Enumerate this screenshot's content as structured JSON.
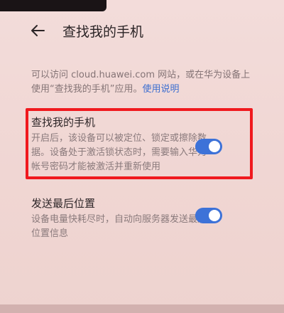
{
  "header": {
    "title": "查找我的手机",
    "back_icon": "arrow-left-icon"
  },
  "info": {
    "text": "可以访问 cloud.huawei.com 网站，或在华为设备上使用“查找我的手机”应用。",
    "link": "使用说明"
  },
  "settings": [
    {
      "name": "查找我的手机",
      "desc": "开启后，该设备可以被定位、锁定或擦除数据。设备处于激活锁状态时，需要输入华为帐号密码才能被激活并重新使用",
      "enabled": true
    },
    {
      "name": "发送最后位置",
      "desc": "设备电量快耗尽时，自动向服务器发送最后位置信息",
      "enabled": true
    }
  ],
  "colors": {
    "accent": "#3d72d8",
    "highlight": "#f0191e"
  }
}
